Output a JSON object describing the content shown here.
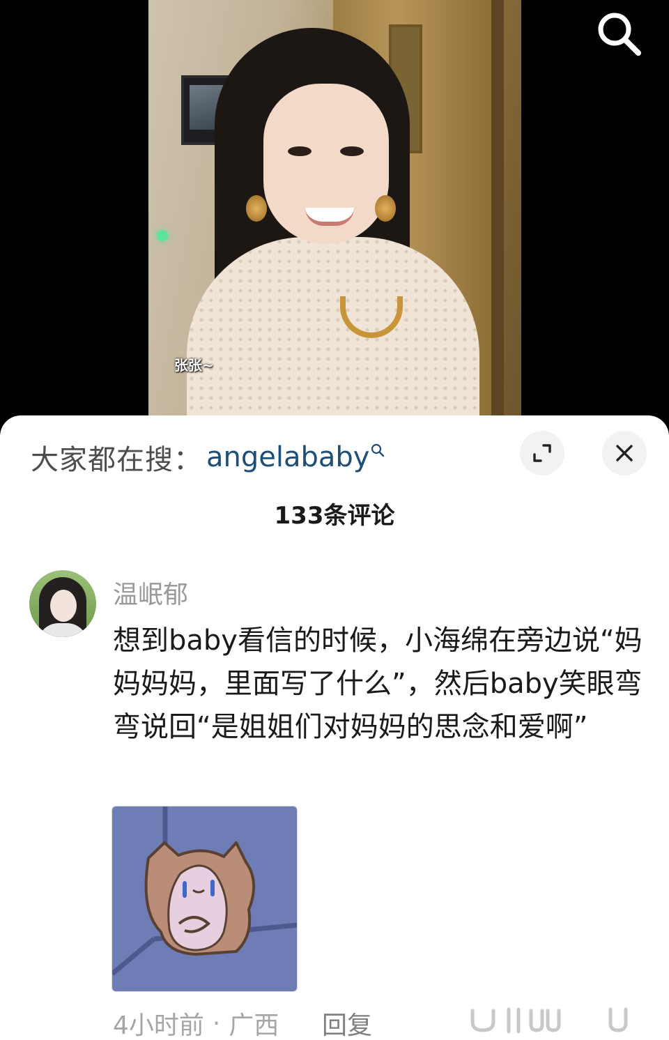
{
  "video": {
    "caption": "张张~"
  },
  "search_button": {
    "icon": "search-icon"
  },
  "sheet": {
    "hot_search_label": "大家都在搜：",
    "hot_search_keyword": "angelababy",
    "comment_count": "133条评论"
  },
  "comment": {
    "username": "温岷郁",
    "text": "想到baby看信的时候，小海绵在旁边说“妈妈妈妈，里面写了什么”，然后baby笑眼弯弯说回“是姐姐们对妈妈的思念和爱啊”",
    "time": "4小时前",
    "separator": "·",
    "location": "广西",
    "reply_label": "回复"
  },
  "colors": {
    "keyword": "#1f4e79",
    "sticker_bg": "#6e7db5",
    "sticker_cat": "#b98d78"
  }
}
